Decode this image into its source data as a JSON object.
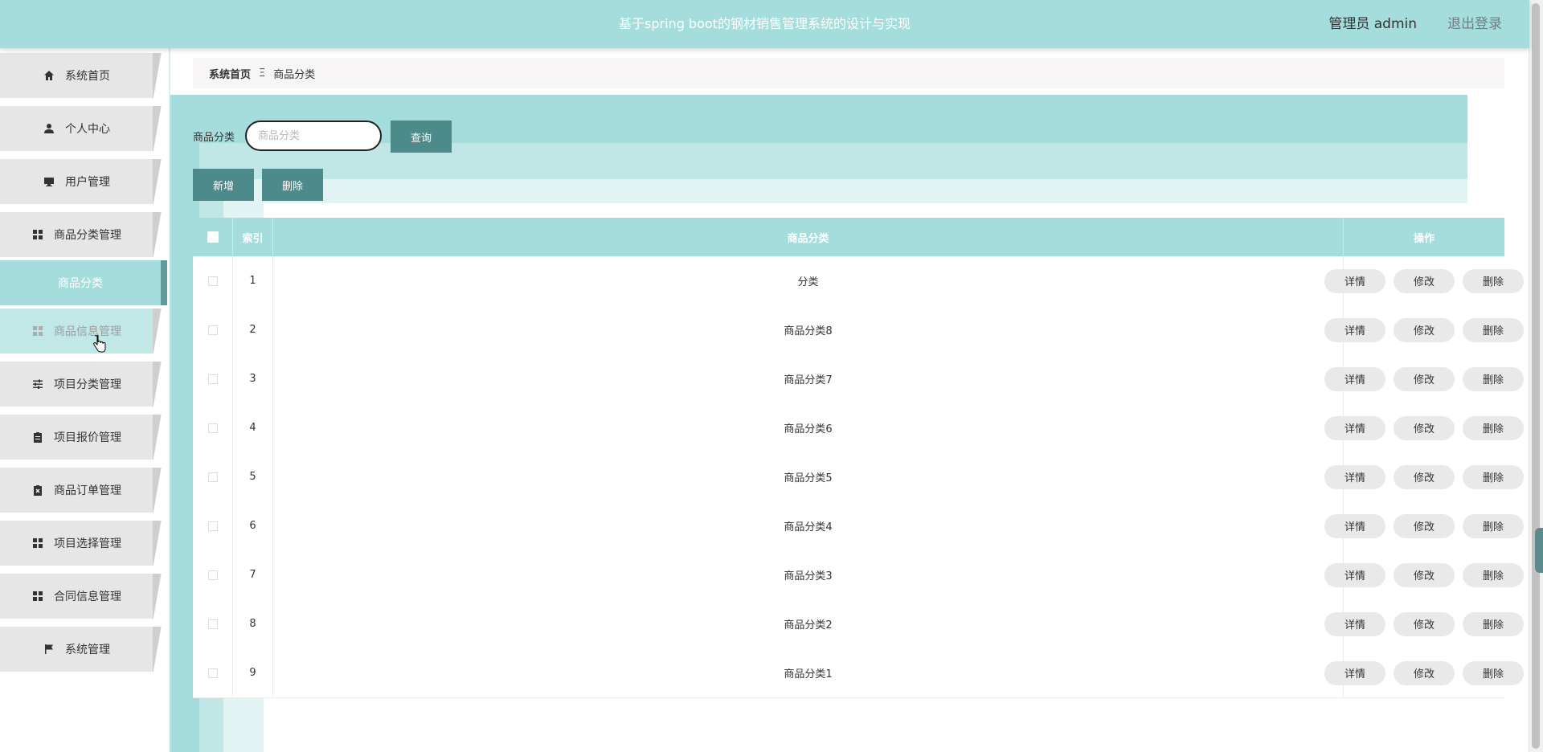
{
  "header": {
    "title": "基于spring boot的钢材销售管理系统的设计与实现",
    "user_label": "管理员 admin",
    "logout": "退出登录"
  },
  "sidebar": {
    "items": [
      {
        "label": "系统首页",
        "icon": "home-icon"
      },
      {
        "label": "个人中心",
        "icon": "person-icon"
      },
      {
        "label": "用户管理",
        "icon": "monitor-icon"
      },
      {
        "label": "商品分类管理",
        "icon": "grid-icon"
      },
      {
        "label": "商品分类",
        "icon": "",
        "sub": true
      },
      {
        "label": "商品信息管理",
        "icon": "grid-icon",
        "hover": true
      },
      {
        "label": "项目分类管理",
        "icon": "sliders-icon"
      },
      {
        "label": "项目报价管理",
        "icon": "clipboard-icon"
      },
      {
        "label": "商品订单管理",
        "icon": "clipboard-x-icon"
      },
      {
        "label": "项目选择管理",
        "icon": "grid-icon"
      },
      {
        "label": "合同信息管理",
        "icon": "grid-icon"
      },
      {
        "label": "系统管理",
        "icon": "flag-icon"
      }
    ]
  },
  "breadcrumb": {
    "home": "系统首页",
    "separator": "Ξ",
    "current": "商品分类"
  },
  "search": {
    "label": "商品分类",
    "placeholder": "商品分类",
    "value": "",
    "button": "查询"
  },
  "actions": {
    "add": "新增",
    "delete": "删除"
  },
  "table": {
    "columns": [
      "索引",
      "商品分类",
      "操作"
    ],
    "rows": [
      {
        "index": "1",
        "name": "分类"
      },
      {
        "index": "2",
        "name": "商品分类8"
      },
      {
        "index": "3",
        "name": "商品分类7"
      },
      {
        "index": "4",
        "name": "商品分类6"
      },
      {
        "index": "5",
        "name": "商品分类5"
      },
      {
        "index": "6",
        "name": "商品分类4"
      },
      {
        "index": "7",
        "name": "商品分类3"
      },
      {
        "index": "8",
        "name": "商品分类2"
      },
      {
        "index": "9",
        "name": "商品分类1"
      }
    ],
    "row_actions": {
      "detail": "详情",
      "edit": "修改",
      "delete": "删除"
    }
  },
  "colors": {
    "accent": "#a5dcdc",
    "button": "#4c8a8c"
  }
}
